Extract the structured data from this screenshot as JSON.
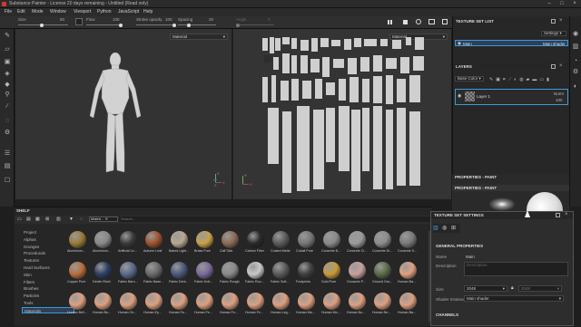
{
  "window": {
    "title": "Substance Painter - License 20 days remaining - Untitled (Read only)"
  },
  "menu": [
    "File",
    "Edit",
    "Mode",
    "Window",
    "Viewport",
    "Python",
    "JavaScript",
    "Help"
  ],
  "toolbar": {
    "size_label": "Size",
    "size_value": "50",
    "flow_label": "Flow",
    "flow_value": "100",
    "stroke_label": "Stroke opacity",
    "stroke_value": "100",
    "spacing_label": "Spacing",
    "spacing_value": "20",
    "angle_label": "Angle",
    "angle_value": "0"
  },
  "viewport3d": {
    "mode": "Material"
  },
  "viewport2d": {
    "mode": "Material"
  },
  "texture_set_list": {
    "title": "TEXTURE SET LIST",
    "settings": "Settings",
    "item": "Main",
    "shader": "Main shader"
  },
  "layers": {
    "title": "LAYERS",
    "channel": "Base Color",
    "layer_name": "Layer 1",
    "blend": "Norm",
    "opacity": "100"
  },
  "properties": {
    "title1": "PROPERTIES - PAINT",
    "title2": "PROPERTIES - PAINT"
  },
  "shelf": {
    "title": "SHELF",
    "filter_tag": "Materi...",
    "search_placeholder": "Search...",
    "categories": [
      "Project",
      "Alphas",
      "Grunges",
      "Procedurals",
      "Textures",
      "Hard Surfaces",
      "Skin",
      "Filters",
      "Brushes",
      "Particles",
      "Tools",
      "Materials"
    ],
    "rows": [
      [
        "Aluminium...",
        "Aluminium...",
        "Artificial Le...",
        "Autumn Leaf",
        "Baked Light...",
        "Brass Pure",
        "Calf Skin",
        "Carbon Fiber",
        "Coated Metal",
        "Cobalt Pure",
        "Concrete B...",
        "Concrete Cl...",
        "Concrete Di...",
        "Concrete S..."
      ],
      [
        "Copper Pure",
        "Denim Rivet",
        "Fabric Barn...",
        "Fabric Base...",
        "Fabric Deni...",
        "Fabric Knit...",
        "Fabric Rough",
        "Fabric Rou...",
        "Fabric Soft...",
        "Footprints",
        "Gold Pure",
        "Gouache P...",
        "Ground Gra...",
        "Human Ba..."
      ],
      [
        "Human Bell...",
        "Human Bu...",
        "Human Ch...",
        "Human Ey...",
        "Human Fa...",
        "Human Fe...",
        "Human Fo...",
        "Human Fe...",
        "Human Leg...",
        "Human Ma...",
        "Human Mo...",
        "Human No...",
        "Human Ne...",
        "Human Ba..."
      ]
    ]
  },
  "tss": {
    "title": "TEXTURE SET SETTINGS",
    "section": "GENERAL PROPERTIES",
    "name_label": "Name",
    "name_value": "Main",
    "desc_label": "Description",
    "desc_placeholder": "Description",
    "size_label": "Size",
    "size_value": "2048",
    "size_value2": "2048",
    "shader_label": "Shader Instance",
    "shader_value": "Main shader",
    "channels": "CHANNELS"
  },
  "colors": {
    "accent": "#3d9ad6",
    "selection": "#2e3f57"
  }
}
